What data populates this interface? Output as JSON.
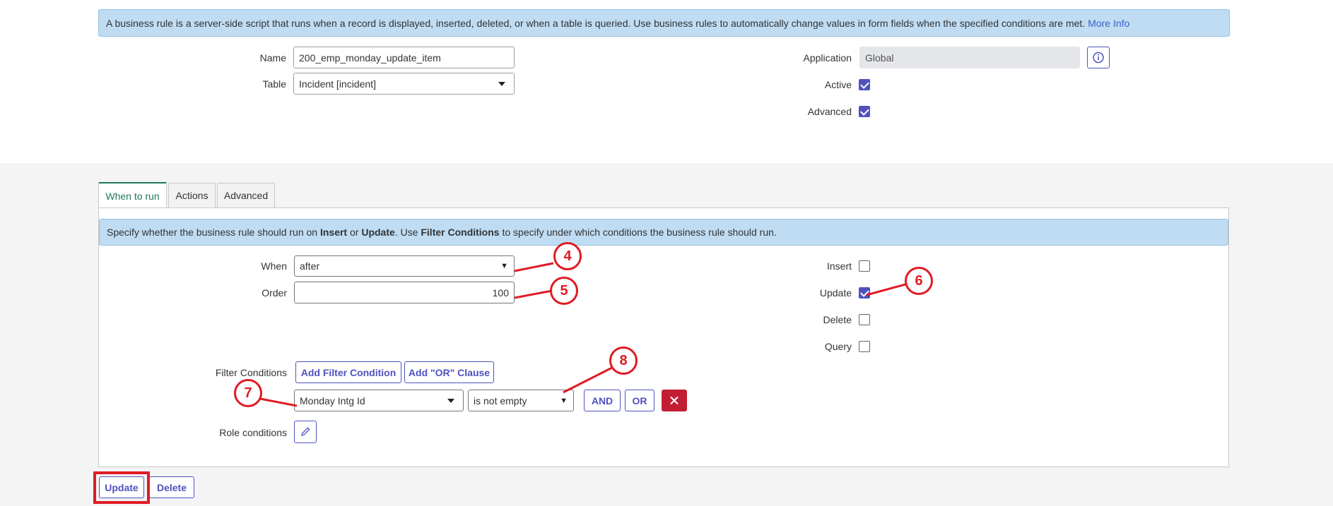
{
  "info_banner": {
    "text": "A business rule is a server-side script that runs when a record is displayed, inserted, deleted, or when a table is queried. Use business rules to automatically change values in form fields when the specified conditions are met.",
    "link": "More Info"
  },
  "form": {
    "name_label": "Name",
    "name_value": "200_emp_monday_update_item",
    "table_label": "Table",
    "table_value": "Incident [incident]",
    "application_label": "Application",
    "application_value": "Global",
    "active_label": "Active",
    "active_checked": true,
    "advanced_label": "Advanced",
    "advanced_checked": true
  },
  "tabs": [
    {
      "label": "When to run",
      "active": true
    },
    {
      "label": "Actions",
      "active": false
    },
    {
      "label": "Advanced",
      "active": false
    }
  ],
  "when_to_run": {
    "banner": {
      "p1": "Specify whether the business rule should run on ",
      "b1": "Insert",
      "p2": " or ",
      "b2": "Update",
      "p3": ". Use ",
      "b3": "Filter Conditions",
      "p4": " to specify under which conditions the business rule should run."
    },
    "when_label": "When",
    "when_value": "after",
    "order_label": "Order",
    "order_value": "100",
    "insert_label": "Insert",
    "insert_checked": false,
    "update_label": "Update",
    "update_checked": true,
    "delete_label": "Delete",
    "delete_checked": false,
    "query_label": "Query",
    "query_checked": false,
    "filter_label": "Filter Conditions",
    "add_filter_label": "Add Filter Condition",
    "add_or_label": "Add \"OR\" Clause",
    "condition_field": "Monday Intg Id",
    "condition_operator": "is not empty",
    "and_label": "AND",
    "or_label": "OR",
    "role_label": "Role conditions"
  },
  "footer": {
    "update_label": "Update",
    "delete_label": "Delete"
  },
  "annotations": [
    "4",
    "5",
    "6",
    "7",
    "8"
  ],
  "colors": {
    "accent": "#4f52bd",
    "banner_bg": "#bfdcf3",
    "active_tab": "#1e7b55",
    "delete_condition": "#c21e33",
    "annotation": "#e01b24"
  }
}
